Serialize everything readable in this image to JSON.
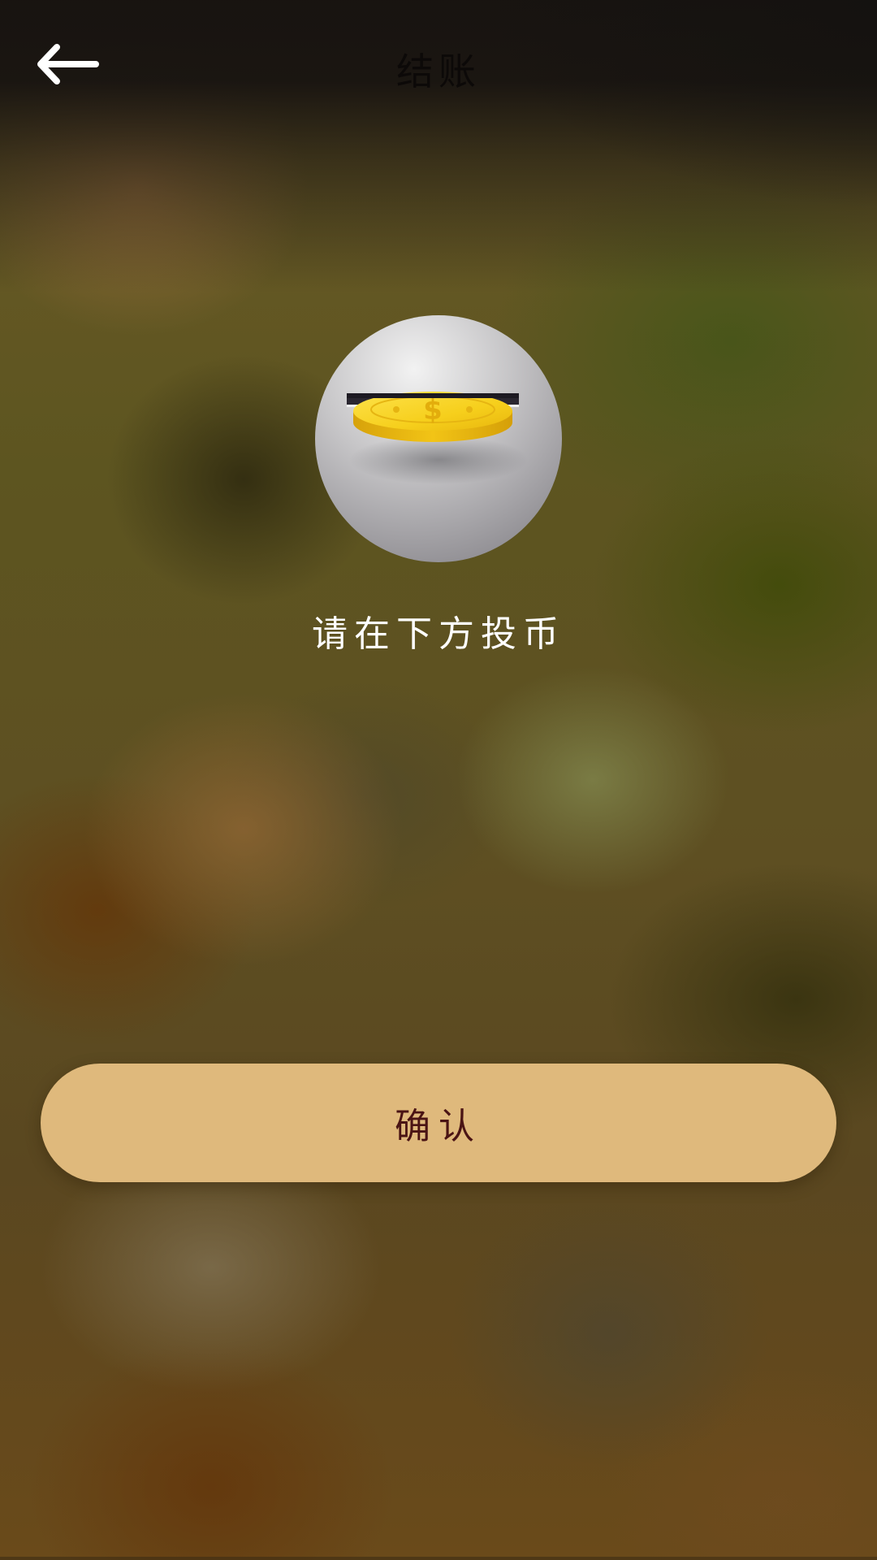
{
  "header": {
    "title": "结账",
    "back_icon": "arrow-left-icon"
  },
  "main": {
    "illustration_icon": "coin-slot-icon",
    "instruction": "请在下方投币"
  },
  "actions": {
    "confirm_label": "确认"
  },
  "colors": {
    "button_fill": "#dfb97c",
    "button_text": "#4a1414",
    "coin_gold": "#f5c518",
    "title_text": "#0c0908"
  }
}
